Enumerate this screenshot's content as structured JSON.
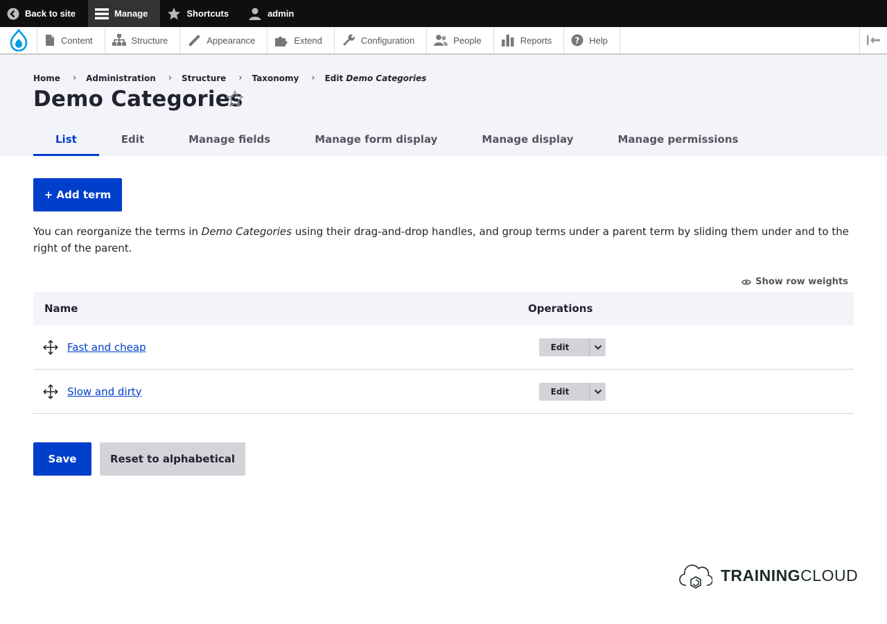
{
  "toolbar": {
    "back": "Back to site",
    "manage": "Manage",
    "shortcuts": "Shortcuts",
    "user": "admin"
  },
  "tray": {
    "items": [
      "Content",
      "Structure",
      "Appearance",
      "Extend",
      "Configuration",
      "People",
      "Reports",
      "Help"
    ]
  },
  "breadcrumb": {
    "items": [
      "Home",
      "Administration",
      "Structure",
      "Taxonomy"
    ],
    "current_prefix": "Edit",
    "current_name": "Demo Categories"
  },
  "page": {
    "title": "Demo Categories"
  },
  "tabs": [
    "List",
    "Edit",
    "Manage fields",
    "Manage form display",
    "Manage display",
    "Manage permissions"
  ],
  "actions": {
    "add_term": "+ Add term",
    "save": "Save",
    "reset": "Reset to alphabetical"
  },
  "help": {
    "before": "You can reorganize the terms in ",
    "vocab": "Demo Categories",
    "after": " using their drag-and-drop handles, and group terms under a parent term by sliding them under and to the right of the parent."
  },
  "table": {
    "show_weights": "Show row weights",
    "col_name": "Name",
    "col_ops": "Operations",
    "rows": [
      {
        "name": "Fast and cheap",
        "op": "Edit"
      },
      {
        "name": "Slow and dirty",
        "op": "Edit"
      }
    ]
  },
  "brand": {
    "bold": "TRAINING",
    "light": "CLOUD"
  },
  "colors": {
    "accent": "#003ecc",
    "toolbar_bg": "#0f0f0f",
    "header_bg": "#f3f4f9"
  }
}
